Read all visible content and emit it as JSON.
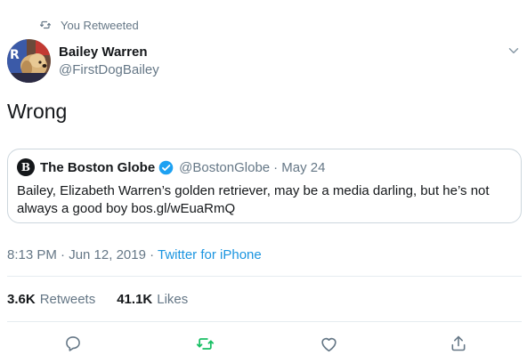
{
  "retweet_banner": {
    "text": "You Retweeted"
  },
  "tweet": {
    "author_name": "Bailey Warren",
    "author_handle": "@FirstDogBailey",
    "text": "Wrong",
    "timestamp": "8:13 PM · Jun 12, 2019",
    "separator": " · ",
    "source": "Twitter for iPhone"
  },
  "quote": {
    "logo_glyph": "B",
    "author_name": "The Boston Globe",
    "author_handle": "@BostonGlobe",
    "date": "· May 24",
    "text": "Bailey, Elizabeth Warren’s golden retriever, may be a media darling, but he’s not always a good boy bos.gl/wEuaRmQ"
  },
  "stats": {
    "retweets_count": "3.6K",
    "retweets_label": "Retweets",
    "likes_count": "41.1K",
    "likes_label": "Likes"
  },
  "colors": {
    "accent_blue": "#1b95e0",
    "retweet_green": "#17bf63",
    "muted": "#657786",
    "border": "#ccd6dd"
  },
  "icons": [
    "retweet-icon",
    "caret-down-icon",
    "verified-badge-icon",
    "reply-icon",
    "retweet-action-icon",
    "like-icon",
    "share-icon"
  ]
}
